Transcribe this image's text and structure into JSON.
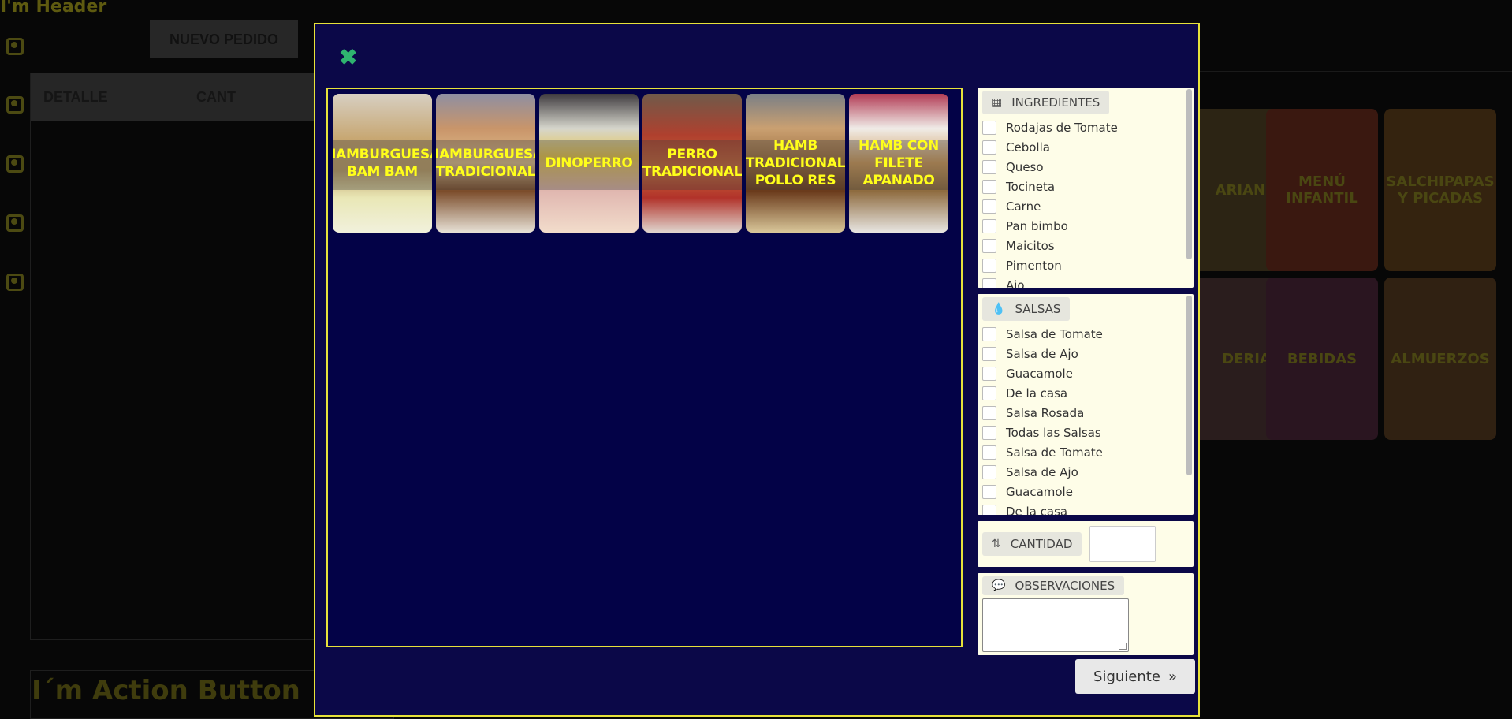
{
  "background": {
    "header_text": "I'm Header",
    "new_order_tab": "NUEVO PEDIDO",
    "order_columns": [
      "DETALLE",
      "CANT"
    ],
    "action_text": "I´m Action Button",
    "categories": [
      "ARIANO",
      "MENÚ INFANTIL",
      "SALCHIPAPAS Y PICADAS",
      "DERIA",
      "BEBIDAS",
      "ALMUERZOS"
    ]
  },
  "modal": {
    "close_icon": "close-icon",
    "products": [
      {
        "label": "HAMBURGUESA BAM BAM"
      },
      {
        "label": "HAMBURGUESA TRADICIONAL"
      },
      {
        "label": "DINOPERRO"
      },
      {
        "label": "PERRO TRADICIONAL"
      },
      {
        "label": "HAMB TRADICIONAL POLLO RES"
      },
      {
        "label": "HAMB CON FILETE APANADO"
      }
    ],
    "ingredients": {
      "title": "INGREDIENTES",
      "icon": "ingredients-grid-icon",
      "items": [
        "Rodajas de Tomate",
        "Cebolla",
        "Queso",
        "Tocineta",
        "Carne",
        "Pan bimbo",
        "Maicitos",
        "Pimenton",
        "Ajo"
      ]
    },
    "sauces": {
      "title": "SALSAS",
      "icon": "drop-icon",
      "items": [
        "Salsa de Tomate",
        "Salsa de Ajo",
        "Guacamole",
        "De la casa",
        "Salsa Rosada",
        "Todas las Salsas",
        "Salsa de Tomate",
        "Salsa de Ajo",
        "Guacamole",
        "De la casa"
      ]
    },
    "quantity": {
      "title": "CANTIDAD",
      "icon": "sort-icon",
      "value": ""
    },
    "observations": {
      "title": "OBSERVACIONES",
      "icon": "comment-icon",
      "value": ""
    },
    "next_label": "Siguiente"
  },
  "colors": {
    "modal_bg": "#0b0848",
    "panel_bg": "#030247",
    "accent": "#e7e23a",
    "product_text": "#ffff1a",
    "close": "#2fb36f"
  }
}
